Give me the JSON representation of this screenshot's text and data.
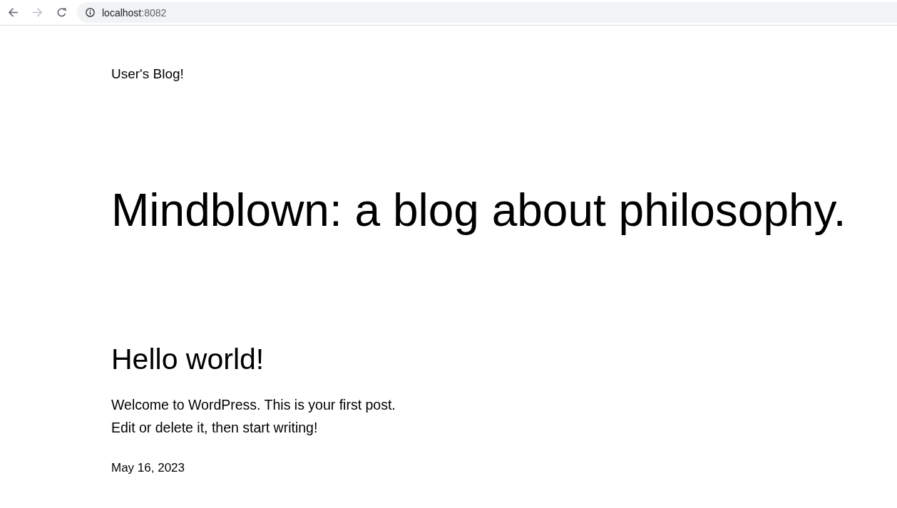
{
  "browser": {
    "nav_buttons": [
      {
        "kind": "back",
        "disabled": false
      },
      {
        "kind": "forward",
        "disabled": true
      },
      {
        "kind": "reload",
        "disabled": false
      }
    ],
    "address_bar": {
      "host": "localhost",
      "port": ":8082"
    }
  },
  "site": {
    "title": "User's Blog!",
    "heading": "Mindblown: a blog about philosophy."
  },
  "posts": [
    {
      "title": "Hello world!",
      "excerpt": "Welcome to WordPress. This is your first post. Edit or delete it, then start writing!",
      "date": "May 16, 2023"
    }
  ]
}
